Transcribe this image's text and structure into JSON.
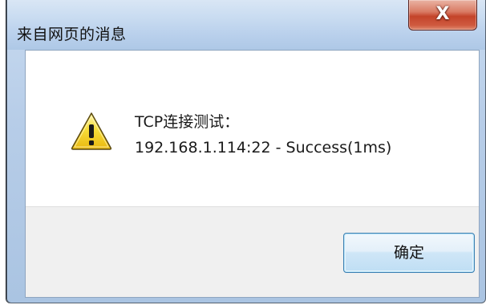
{
  "dialog": {
    "title": "来自网页的消息",
    "close_icon": "close-icon",
    "close_glyph": "X",
    "message_icon": "warning-icon",
    "message": {
      "line1": "TCP连接测试：",
      "line2": "192.168.1.114:22 - Success(1ms)"
    },
    "ok_label": "确定"
  },
  "colors": {
    "title_bar": "#c9dcf1",
    "close_button": "#c4442a",
    "button_area": "#f0f0f0",
    "ok_button_border": "#3c7fb1",
    "warning_fill": "#f4d221"
  }
}
